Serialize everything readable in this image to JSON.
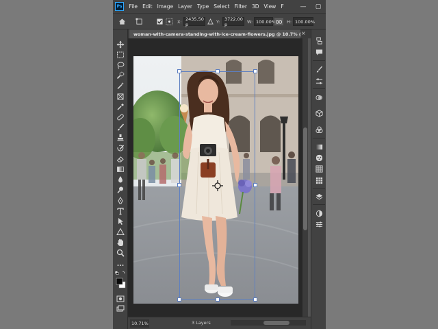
{
  "app": {
    "logo_text": "Ps",
    "menu": [
      "File",
      "Edit",
      "Image",
      "Layer",
      "Type",
      "Select",
      "Filter",
      "3D",
      "View",
      "F"
    ],
    "window_controls": [
      "—",
      "▢"
    ]
  },
  "options_bar": {
    "x_label": "X:",
    "x_value": "2435.50 p",
    "y_label": "Y:",
    "y_value": "3722.00 p",
    "w_label": "W:",
    "w_value": "100.00%",
    "h_label": "H:",
    "h_value": "100.00%"
  },
  "document": {
    "tab_title": "woman-with-camera-standing-with-ice-cream-flowers.jpg @ 10.7% (L...",
    "close_symbol": "×"
  },
  "status": {
    "zoom": "10.71%",
    "layers": "3 Layers"
  },
  "colors": {
    "accent": "#31a8ff",
    "panel": "#424242",
    "workspace": "#535353",
    "canvas_bg": "#282828",
    "transform_box": "#5d7fc1"
  },
  "tools": [
    "move-tool-icon",
    "artboard-tool-icon",
    "lasso-tool-icon",
    "quick-select-tool-icon",
    "magic-wand-tool-icon",
    "crop-tool-icon",
    "eyedropper-tool-icon",
    "healing-brush-tool-icon",
    "brush-tool-icon",
    "clone-stamp-tool-icon",
    "history-brush-tool-icon",
    "eraser-tool-icon",
    "gradient-tool-icon",
    "blur-tool-icon",
    "dodge-tool-icon",
    "pen-tool-icon",
    "type-tool-icon",
    "path-select-tool-icon",
    "shape-tool-icon",
    "hand-tool-icon",
    "zoom-tool-icon",
    "more-tools-icon",
    "color-swatches-icon",
    "quick-mask-icon",
    "screen-mode-icon"
  ],
  "panels": [
    "history-panel-icon",
    "comments-panel-icon",
    "brush-settings-icon",
    "properties-icon",
    "adjustments-icon",
    "3d-panel-icon",
    "channels-icon",
    "gradients-icon",
    "patterns-icon",
    "swatches-icon",
    "layers-panel-icon",
    "adjust-circle-icon",
    "sliders-icon"
  ]
}
